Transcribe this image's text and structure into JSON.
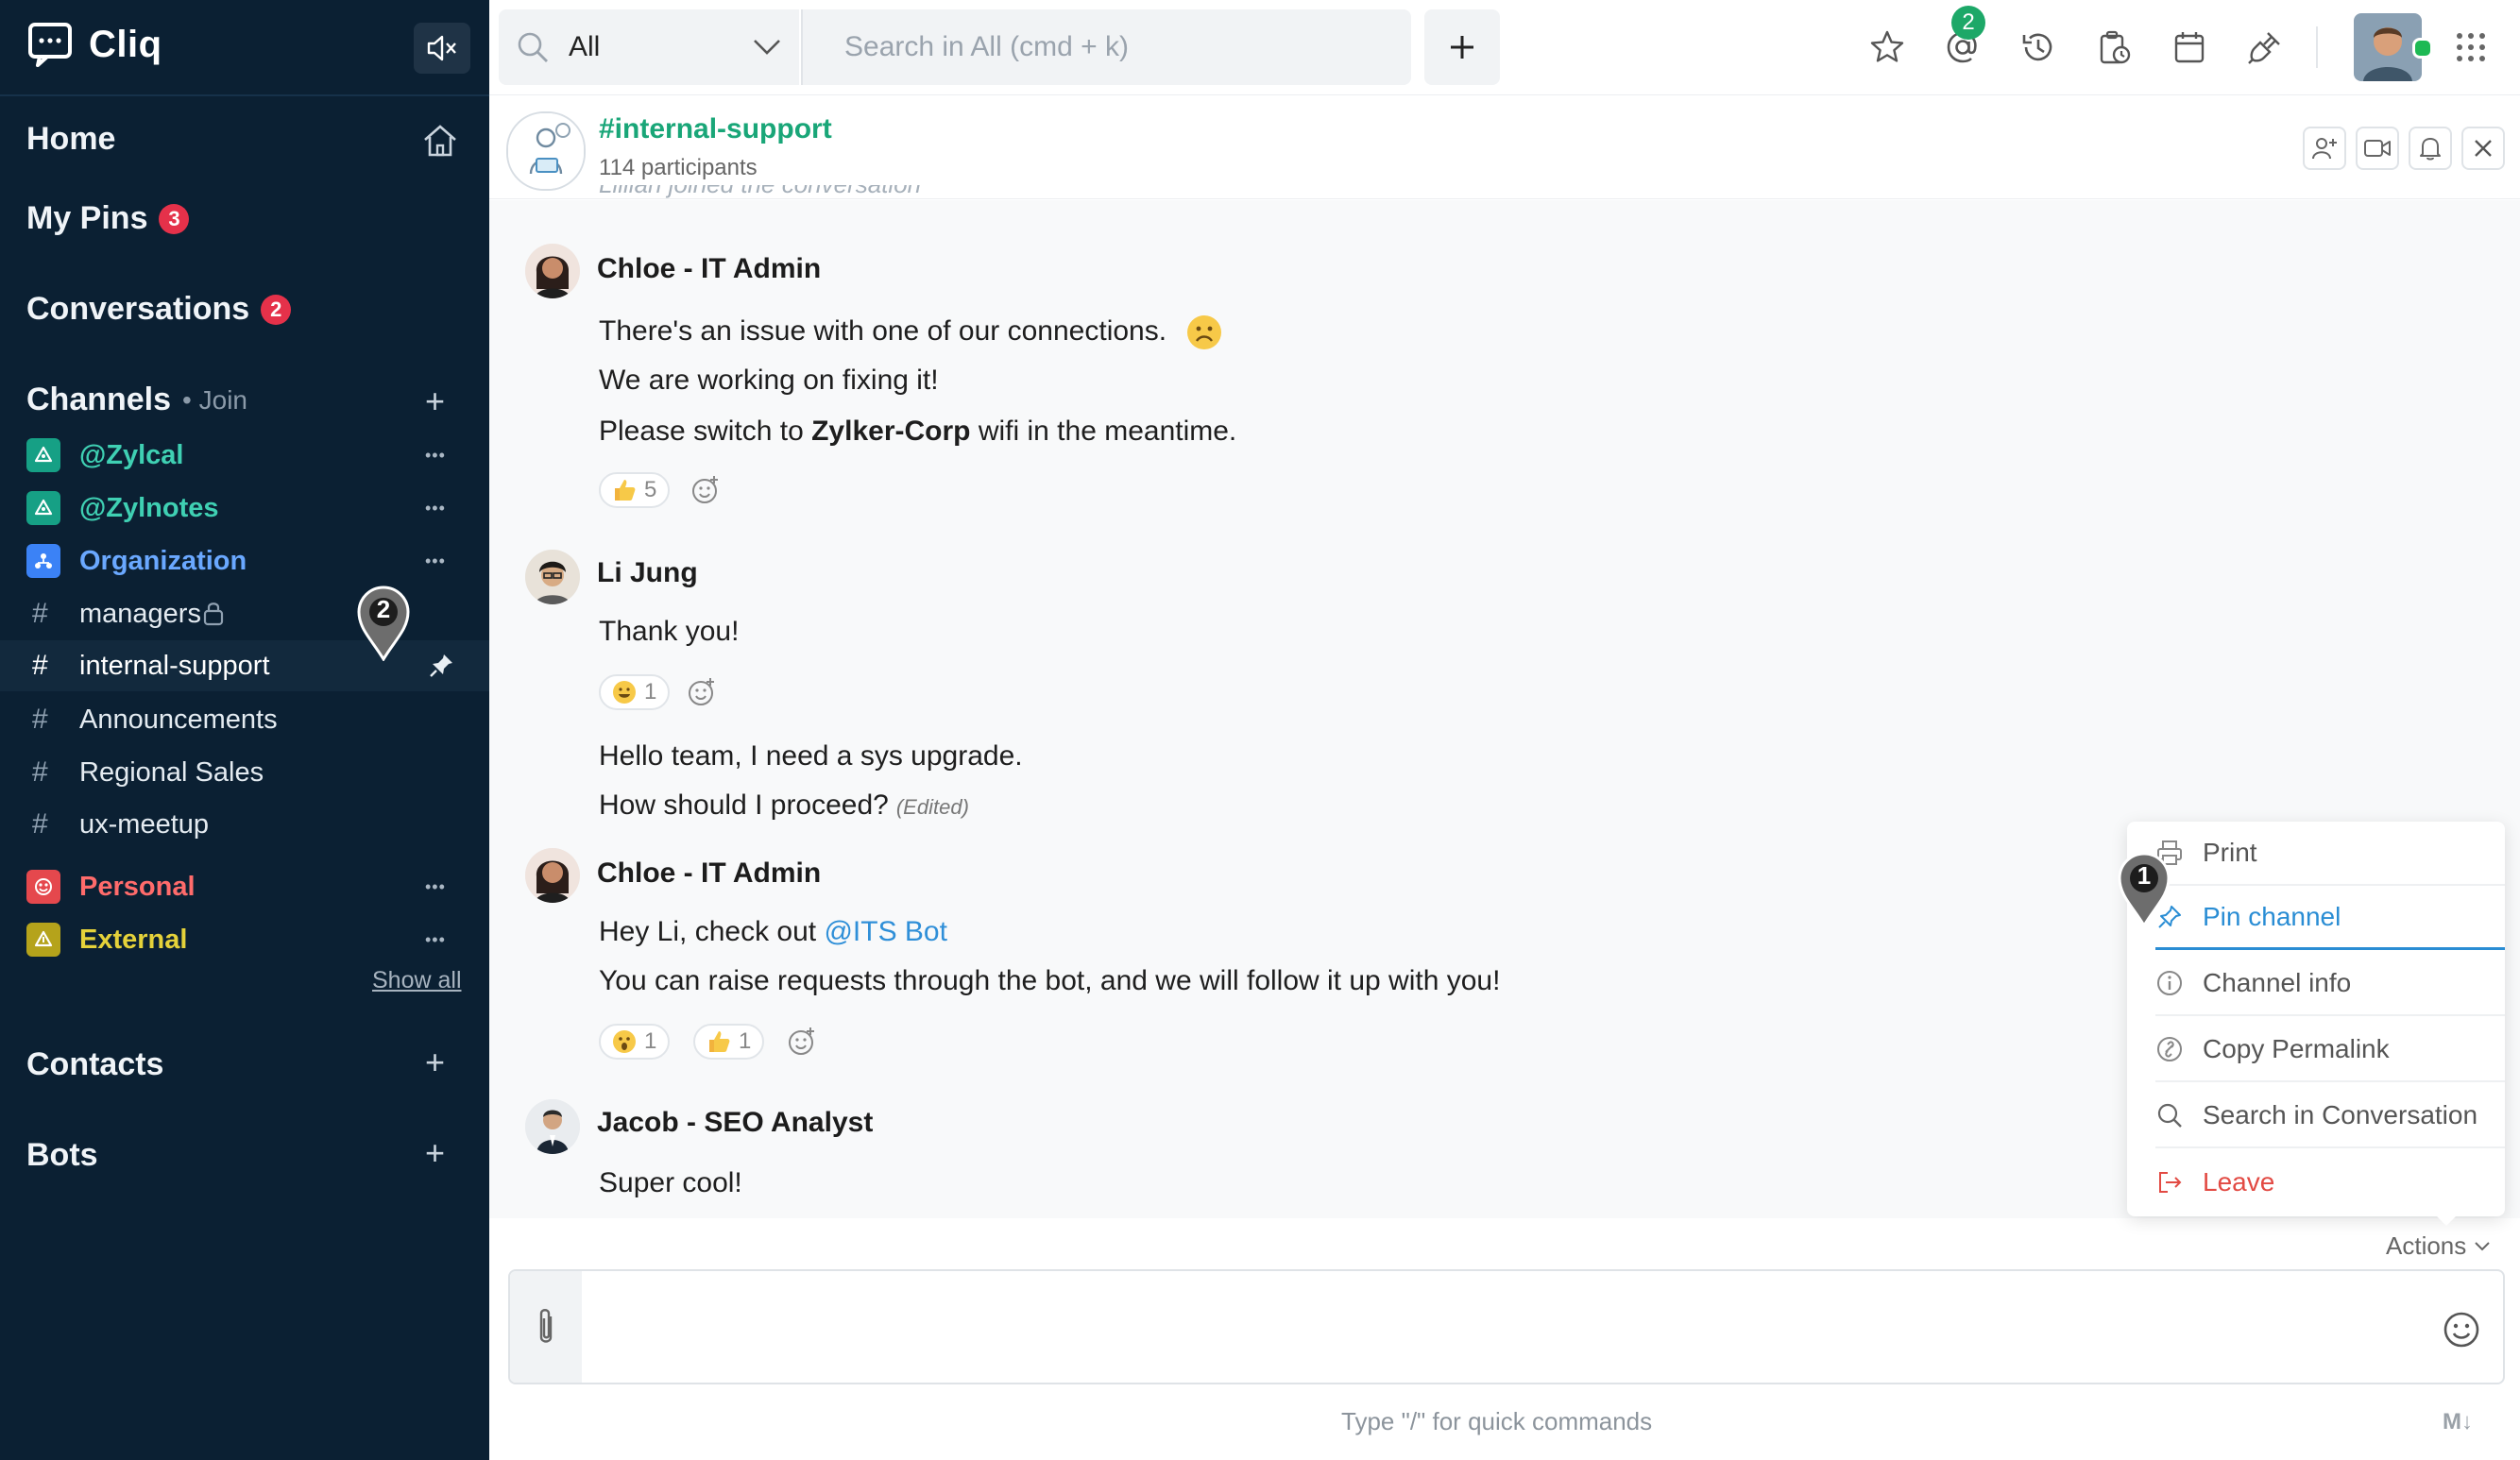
{
  "app": {
    "name": "Cliq",
    "icons": {
      "logo": "chat-logo-icon",
      "mute": "speaker-mute-icon"
    }
  },
  "sidebar": {
    "home": "Home",
    "my_pins": {
      "label": "My Pins",
      "count": "3"
    },
    "conversations": {
      "label": "Conversations",
      "count": "2"
    },
    "channels": {
      "label": "Channels",
      "join": "• Join",
      "items": [
        {
          "label": "@Zylcal",
          "kind": "team",
          "color": "#16a085",
          "text_color": "#3fd0b3"
        },
        {
          "label": "@Zylnotes",
          "kind": "team",
          "color": "#16a085",
          "text_color": "#3fd0b3"
        },
        {
          "label": "Organization",
          "kind": "org",
          "color": "#3b82f6",
          "text_color": "#6aa8ff"
        },
        {
          "label": "managers",
          "kind": "hash",
          "locked": true
        },
        {
          "label": "internal-support",
          "kind": "hash",
          "active": true,
          "pinned": true
        },
        {
          "label": "Announcements",
          "kind": "hash"
        },
        {
          "label": "Regional Sales",
          "kind": "hash"
        },
        {
          "label": "ux-meetup",
          "kind": "hash"
        },
        {
          "label": "Personal",
          "kind": "personal",
          "color": "#e5484d",
          "text_color": "#ff6b6b"
        },
        {
          "label": "External",
          "kind": "external",
          "color": "#b5a31b",
          "text_color": "#e5d23a"
        }
      ],
      "show_all": "Show all"
    },
    "contacts": "Contacts",
    "bots": "Bots"
  },
  "topbar": {
    "scope": "All",
    "search_placeholder": "Search in All (cmd + k)",
    "mention_count": "2",
    "icons": [
      "star-icon",
      "mention-icon",
      "history-icon",
      "reminder-icon",
      "calendar-icon",
      "integrations-icon",
      "apps-grid-icon"
    ]
  },
  "channel": {
    "title": "#internal-support",
    "participants": "114 participants",
    "system_line": "Lillian joined the conversation"
  },
  "messages": [
    {
      "author": "Chloe - IT Admin",
      "lines": [
        "There's an issue with one of our connections.",
        "We are working on fixing it!"
      ],
      "line3_before": "Please switch to ",
      "line3_bold": "Zylker-Corp",
      "line3_after": " wifi in the meantime.",
      "reactions": [
        {
          "emoji": "thumbs-up",
          "count": "5"
        }
      ]
    },
    {
      "author": "Li Jung",
      "lines": [
        "Thank you!"
      ],
      "reactions": [
        {
          "emoji": "grin",
          "count": "1"
        }
      ],
      "followup": [
        "Hello team, I need a sys upgrade.",
        "How should I proceed?"
      ],
      "edited": "(Edited)"
    },
    {
      "author": "Chloe - IT Admin",
      "line1_before": "Hey Li, check out ",
      "line1_mention": "@ITS Bot",
      "lines": [
        "You can raise requests through the bot, and we will follow it up with you!"
      ],
      "reactions": [
        {
          "emoji": "shocked",
          "count": "1"
        },
        {
          "emoji": "thumbs-up",
          "count": "1"
        }
      ]
    },
    {
      "author": "Jacob - SEO Analyst",
      "lines": [
        "Super cool!"
      ]
    }
  ],
  "actions_menu": {
    "items": [
      "Print",
      "Pin channel",
      "Channel info",
      "Copy Permalink",
      "Search in Conversation",
      "Leave"
    ],
    "toggle": "Actions"
  },
  "composer": {
    "hint": "Type \"/\" for quick commands",
    "markdown": "M↓"
  },
  "callouts": [
    "1",
    "2"
  ]
}
